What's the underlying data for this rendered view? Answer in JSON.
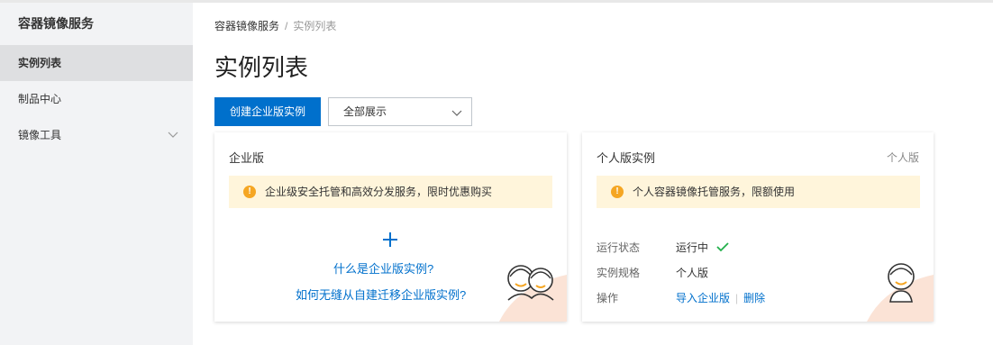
{
  "sidebar": {
    "title": "容器镜像服务",
    "items": [
      {
        "label": "实例列表"
      },
      {
        "label": "制品中心"
      },
      {
        "label": "镜像工具"
      }
    ]
  },
  "breadcrumb": {
    "root": "容器镜像服务",
    "separator": "/",
    "current": "实例列表"
  },
  "page": {
    "title": "实例列表"
  },
  "toolbar": {
    "create_label": "创建企业版实例",
    "filter_value": "全部展示"
  },
  "enterprise_card": {
    "title": "企业版",
    "notice": "企业级安全托管和高效分发服务，限时优惠购买",
    "link_what": "什么是企业版实例?",
    "link_migrate": "如何无缝从自建迁移企业版实例?"
  },
  "personal_card": {
    "title": "个人版实例",
    "tag": "个人版",
    "notice": "个人容器镜像托管服务，限额使用",
    "status_label": "运行状态",
    "status_value": "运行中",
    "spec_label": "实例规格",
    "spec_value": "个人版",
    "ops_label": "操作",
    "op_import": "导入企业版",
    "op_delete": "删除"
  },
  "colors": {
    "primary": "#0070cc",
    "warning": "#f5a623",
    "success": "#22b04b",
    "notice_bg": "#fff5db"
  }
}
